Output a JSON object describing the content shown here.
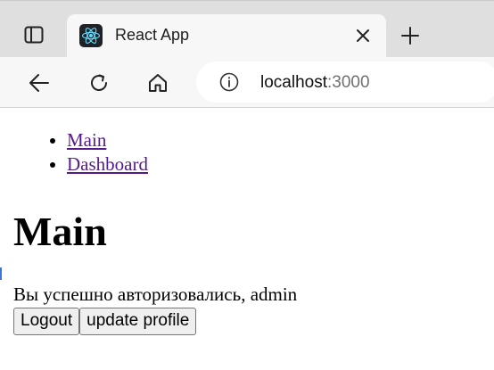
{
  "browser": {
    "tab": {
      "title": "React App",
      "favicon": "react-logo-icon"
    },
    "address": {
      "host": "localhost",
      "port": ":3000"
    },
    "icons": {
      "sidebar": "sidebar-icon",
      "close": "close-icon",
      "new_tab": "plus-icon",
      "back": "back-arrow-icon",
      "reload": "reload-icon",
      "home": "home-icon",
      "site_info": "info-icon"
    },
    "colors": {
      "react_logo": "#61dafb",
      "tabstrip": "#dfdfdf",
      "toolbar": "#f7f7f7"
    }
  },
  "page": {
    "nav": [
      {
        "label": "Main"
      },
      {
        "label": "Dashboard"
      }
    ],
    "title": "Main",
    "status": "Вы успешно авторизовались, admin",
    "buttons": {
      "logout": "Logout",
      "update_profile": "update profile"
    },
    "colors": {
      "link": "#551a8b",
      "button_bg": "#efefef"
    }
  }
}
